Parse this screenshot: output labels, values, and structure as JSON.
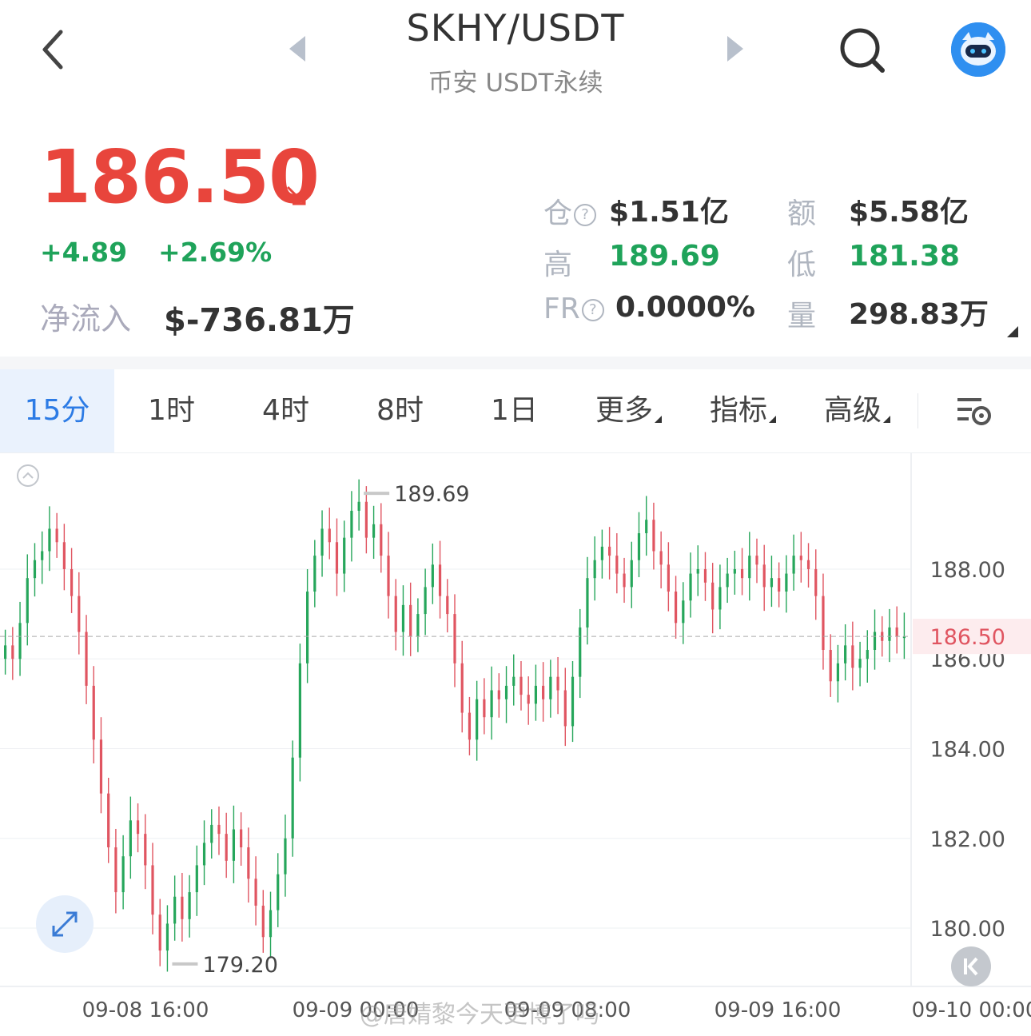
{
  "header": {
    "title": "SKHY/USDT",
    "subtitle": "币安 USDT永续"
  },
  "price": {
    "last": "186.50",
    "change": "+4.89",
    "change_pct": "+2.69%",
    "net_flow_label": "净流入",
    "net_flow_value": "$-736.81万"
  },
  "stats": {
    "open_interest_label": "仓",
    "open_interest_value": "$1.51亿",
    "turnover_label": "额",
    "turnover_value": "$5.58亿",
    "high_label": "高",
    "high_value": "189.69",
    "low_label": "低",
    "low_value": "181.38",
    "fr_label": "FR",
    "fr_value": "0.0000%",
    "volume_label": "量",
    "volume_value": "298.83万",
    "help_glyph": "?"
  },
  "tabs": [
    {
      "label": "15分",
      "active": true
    },
    {
      "label": "1时"
    },
    {
      "label": "4时"
    },
    {
      "label": "8时"
    },
    {
      "label": "1日"
    },
    {
      "label": "更多",
      "dropdown": true
    },
    {
      "label": "指标",
      "dropdown": true
    },
    {
      "label": "高级",
      "dropdown": true
    }
  ],
  "colors": {
    "up": "#26a65b",
    "down": "#e05561",
    "price_red": "#e8453c",
    "accent": "#2c7be5"
  },
  "chart_data": {
    "type": "candlestick",
    "y_ticks": [
      "188.00",
      "186.00",
      "184.00",
      "182.00",
      "180.00"
    ],
    "ylim": [
      178.7,
      190.6
    ],
    "current_price": "186.50",
    "max_label": "189.69",
    "min_label": "179.20",
    "x_ticks": [
      "09-08 16:00",
      "09-09 00:00",
      "09-09 08:00",
      "09-09 16:00",
      "09-10 00:00"
    ],
    "watermark": "@唐婧黎今天更博了吗",
    "closes": [
      186.3,
      186.0,
      186.8,
      187.8,
      188.2,
      188.4,
      188.9,
      188.6,
      188.0,
      187.4,
      186.6,
      185.4,
      184.2,
      183.0,
      181.8,
      180.8,
      181.6,
      182.4,
      182.1,
      181.4,
      180.3,
      179.5,
      180.1,
      180.7,
      180.2,
      180.8,
      181.4,
      181.9,
      182.3,
      182.1,
      181.5,
      182.2,
      181.8,
      181.1,
      180.5,
      179.8,
      180.4,
      181.2,
      182.0,
      183.8,
      185.9,
      187.5,
      188.3,
      188.9,
      188.6,
      187.9,
      188.7,
      189.3,
      189.5,
      188.7,
      189.0,
      188.3,
      187.4,
      186.6,
      187.2,
      186.5,
      187.0,
      187.6,
      188.1,
      187.4,
      187.0,
      185.9,
      184.8,
      184.2,
      185.1,
      184.7,
      185.3,
      185.1,
      185.4,
      185.6,
      185.2,
      185.0,
      185.4,
      185.1,
      185.6,
      185.3,
      184.5,
      185.6,
      186.7,
      187.8,
      188.2,
      188.5,
      188.3,
      187.9,
      187.6,
      188.2,
      188.8,
      189.1,
      188.4,
      188.1,
      187.5,
      186.8,
      187.3,
      187.9,
      188.0,
      187.7,
      187.1,
      187.6,
      187.9,
      188.0,
      187.8,
      188.3,
      188.1,
      187.6,
      187.8,
      187.5,
      187.9,
      188.3,
      188.2,
      188.0,
      187.4,
      186.2,
      185.5,
      185.9,
      186.3,
      185.8,
      186.0,
      186.2,
      186.6,
      186.4,
      186.7,
      186.5,
      186.5
    ]
  }
}
